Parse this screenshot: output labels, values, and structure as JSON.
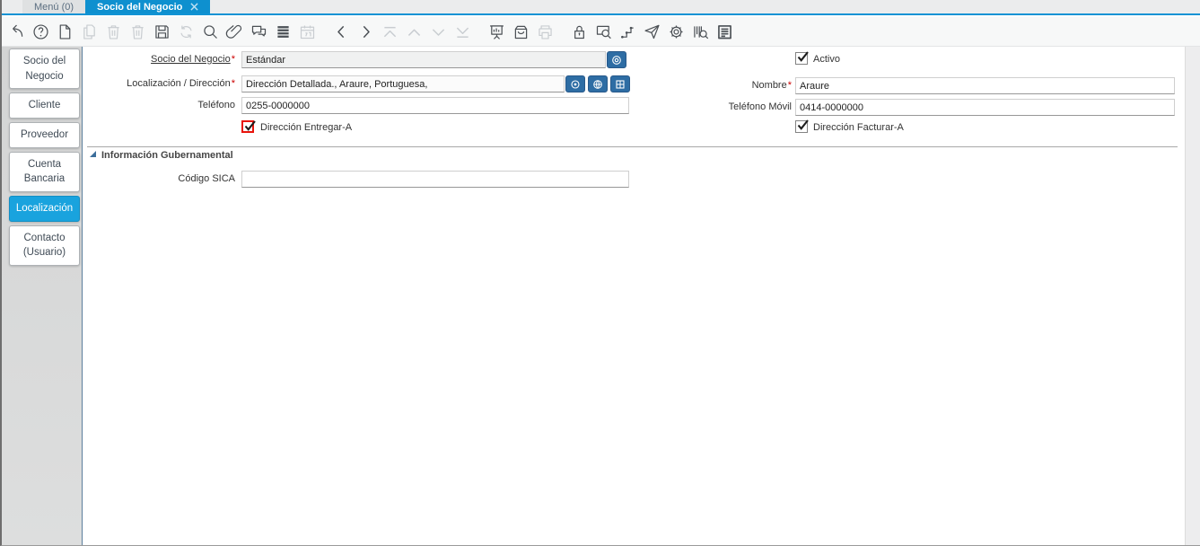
{
  "window_tabs": [
    {
      "name": "menu",
      "label": "Menú (0)",
      "active": false
    },
    {
      "name": "socio-del-negocio",
      "label": "Socio del Negocio",
      "active": true,
      "closable": true
    }
  ],
  "toolbar": {
    "items": [
      {
        "name": "undo",
        "enabled": true
      },
      {
        "name": "help",
        "enabled": true
      },
      {
        "name": "new-record",
        "enabled": true
      },
      {
        "name": "copy-record",
        "enabled": false
      },
      {
        "name": "delete-record",
        "enabled": false
      },
      {
        "name": "delete-selection",
        "enabled": false
      },
      {
        "name": "save",
        "enabled": true
      },
      {
        "name": "refresh",
        "enabled": false
      },
      {
        "name": "find",
        "enabled": true
      },
      {
        "name": "attachment",
        "enabled": true
      },
      {
        "name": "chat",
        "enabled": true
      },
      {
        "name": "toggle-grid",
        "enabled": true
      },
      {
        "name": "calendar",
        "enabled": false
      },
      {
        "name": "previous-record",
        "enabled": true,
        "group": true
      },
      {
        "name": "next-record",
        "enabled": true
      },
      {
        "name": "first-record",
        "enabled": false
      },
      {
        "name": "parent-record",
        "enabled": false
      },
      {
        "name": "detail-record",
        "enabled": false
      },
      {
        "name": "last-record",
        "enabled": false
      },
      {
        "name": "chart",
        "enabled": true,
        "group": true
      },
      {
        "name": "archive",
        "enabled": true
      },
      {
        "name": "print",
        "enabled": false
      },
      {
        "name": "lock",
        "enabled": true,
        "group": true
      },
      {
        "name": "zoom-across",
        "enabled": true
      },
      {
        "name": "workflow",
        "enabled": true
      },
      {
        "name": "send-mail",
        "enabled": true
      },
      {
        "name": "preferences",
        "enabled": true
      },
      {
        "name": "product-info",
        "enabled": true
      },
      {
        "name": "report",
        "enabled": true
      }
    ]
  },
  "sidebar": {
    "tabs": [
      {
        "name": "socio-del-negocio",
        "label": "Socio del Negocio",
        "active": false
      },
      {
        "name": "cliente",
        "label": "Cliente",
        "active": false
      },
      {
        "name": "proveedor",
        "label": "Proveedor",
        "active": false
      },
      {
        "name": "cuenta-bancaria",
        "label": "Cuenta Bancaria",
        "active": false
      },
      {
        "name": "localizacion",
        "label": "Localización",
        "active": true
      },
      {
        "name": "contacto-usuario",
        "label": "Contacto (Usuario)",
        "active": false
      }
    ]
  },
  "form": {
    "required_mark": "*",
    "fields": {
      "socio": {
        "label": "Socio del Negocio",
        "value": "Estándar",
        "required": true
      },
      "localizacion": {
        "label": "Localización / Dirección",
        "value": "Dirección Detallada., Araure, Portuguesa,",
        "required": true
      },
      "telefono": {
        "label": "Teléfono",
        "value": "0255-0000000"
      },
      "direccion_entregar": {
        "label": "Dirección Entregar-A",
        "checked": true
      },
      "activo": {
        "label": "Activo",
        "checked": true
      },
      "nombre": {
        "label": "Nombre",
        "value": "Araure",
        "required": true
      },
      "telefono_movil": {
        "label": "Teléfono Móvil",
        "value": "0414-0000000"
      },
      "direccion_facturar": {
        "label": "Dirección Facturar-A",
        "checked": true
      },
      "codigo_sica": {
        "label": "Código SICA",
        "value": ""
      }
    },
    "section": {
      "title": "Información Gubernamental"
    }
  },
  "colors": {
    "accent": "#1193d4",
    "active_tab": "#0e90cf",
    "sidebar_active": "#19a3de",
    "field_button": "#2e6da4",
    "required": "#cc0000",
    "checkbox_highlight": "#e8140c"
  }
}
